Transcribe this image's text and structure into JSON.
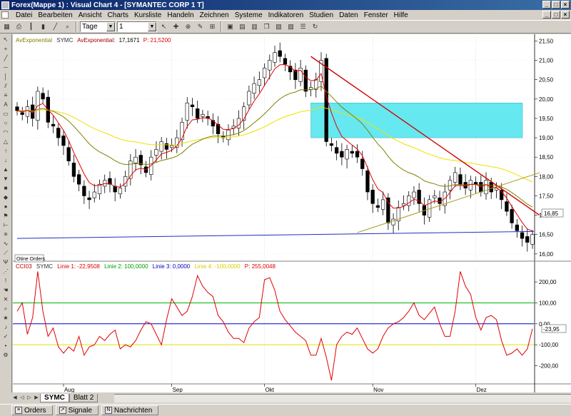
{
  "window": {
    "title": "Forex(Mappe 1) : Visual Chart 4 - [SYMANTEC CORP 1 T]",
    "min_glyph": "_",
    "max_glyph": "□",
    "close_glyph": "×"
  },
  "menu": [
    "Datei",
    "Bearbeiten",
    "Ansicht",
    "Charts",
    "Kursliste",
    "Handeln",
    "Zeichnen",
    "Systeme",
    "Indikatoren",
    "Studien",
    "Daten",
    "Fenster",
    "Hilfe"
  ],
  "toolbar": {
    "period_value": "Tage",
    "count_value": "1"
  },
  "price_legend": {
    "prefix": "AvExponential",
    "symbol": "SYMC",
    "name": "AvExponential:",
    "value": "17,1671",
    "p_label": "P: 21,5200"
  },
  "osc_legend": {
    "name": "CCI03",
    "symbol": "SYMC",
    "l1": "Linie 1: -22,9508",
    "l2": "Linie 2: 100,0000",
    "l3": "Linie 3: 0,0000",
    "l4": "Linie 4: -100,0000",
    "p": "P: 255,0048"
  },
  "orders_box": "Otine Orders",
  "price_tag": "16,85",
  "osc_tag": "-23,95",
  "sheet_tabs": [
    "SYMC",
    "Blatt 2"
  ],
  "status_tabs": [
    "Orders",
    "Signale",
    "Nachrichten"
  ],
  "colors": {
    "price_ma_fast": "#e00000",
    "price_ma_mid": "#808000",
    "price_ma_slow": "#f0e000",
    "support": "#2030c0",
    "box": "#66e8f0",
    "cci": "#e00000",
    "line_100": "#00b000",
    "line_0": "#0000c0",
    "line_m100": "#e8e000"
  },
  "chart_data": [
    {
      "type": "candlestick",
      "title": "",
      "y_ticks": [
        "21,50",
        "21,00",
        "20,50",
        "20,00",
        "19,50",
        "19,00",
        "18,50",
        "18,00",
        "17,50",
        "17,00",
        "16,50",
        "16,00"
      ],
      "ylim": [
        15.85,
        21.6
      ],
      "x_labels": [
        "Aug",
        "Sep",
        "Okt",
        "Nov",
        "Dez"
      ],
      "x_label_index": [
        9,
        30,
        48,
        69,
        89
      ],
      "n_bars": 101,
      "series": [
        {
          "name": "SYMC",
          "closes": [
            19.7,
            19.6,
            19.8,
            19.5,
            20.2,
            20.0,
            19.4,
            19.3,
            19.0,
            18.8,
            18.4,
            18.0,
            17.8,
            17.5,
            17.4,
            17.6,
            17.8,
            17.9,
            17.8,
            17.6,
            17.7,
            18.0,
            18.4,
            18.5,
            18.3,
            18.1,
            18.5,
            18.7,
            18.9,
            18.7,
            18.8,
            19.0,
            19.4,
            19.9,
            19.8,
            19.5,
            19.6,
            19.5,
            19.3,
            19.1,
            19.0,
            19.2,
            19.3,
            19.5,
            19.8,
            20.2,
            20.4,
            20.5,
            20.8,
            21.0,
            21.2,
            21.1,
            20.9,
            20.7,
            20.5,
            20.8,
            20.2,
            20.3,
            20.5,
            21.0,
            18.9,
            18.8,
            18.6,
            18.5,
            18.7,
            18.6,
            18.5,
            18.2,
            17.6,
            17.3,
            17.2,
            17.4,
            16.8,
            16.9,
            17.2,
            17.3,
            17.5,
            17.6,
            17.3,
            17.0,
            17.4,
            17.5,
            17.3,
            17.6,
            17.9,
            18.1,
            17.8,
            17.7,
            17.9,
            17.8,
            17.6,
            17.9,
            17.6,
            17.7,
            17.4,
            17.1,
            16.8,
            16.6,
            16.4,
            16.3,
            16.5
          ]
        }
      ],
      "overlays": [
        {
          "name": "fast",
          "values": "ema5"
        },
        {
          "name": "mid",
          "values": "ema20"
        },
        {
          "name": "slow",
          "values": "ema50"
        }
      ],
      "support_line": {
        "from": [
          0,
          16.4
        ],
        "to": [
          100,
          16.58
        ]
      },
      "trend_down": {
        "from": [
          57,
          21.1
        ],
        "to": [
          100,
          17.0
        ]
      },
      "trend_up": {
        "from": [
          66,
          16.55
        ],
        "to": [
          100,
          18.1
        ]
      },
      "zone": {
        "x": [
          57,
          100
        ],
        "y": [
          19.0,
          19.9
        ]
      }
    },
    {
      "type": "line",
      "title": "",
      "y_ticks": [
        "200,00",
        "100,00",
        "0,00",
        "-100,00",
        "-200,00"
      ],
      "ylim": [
        -280,
        265
      ],
      "series": [
        {
          "name": "CCI03",
          "values": [
            60,
            100,
            -50,
            30,
            250,
            60,
            -60,
            -20,
            -110,
            -140,
            -110,
            -130,
            -60,
            -150,
            -110,
            -100,
            -60,
            -80,
            -50,
            -30,
            -120,
            -100,
            -110,
            -80,
            -30,
            10,
            0,
            -50,
            -100,
            20,
            120,
            80,
            40,
            60,
            130,
            230,
            180,
            150,
            130,
            40,
            10,
            -40,
            -70,
            -70,
            -90,
            -20,
            10,
            30,
            210,
            220,
            160,
            60,
            20,
            -10,
            -40,
            -60,
            -80,
            -150,
            -150,
            -70,
            -160,
            -270,
            -100,
            -60,
            -40,
            -50,
            -20,
            -70,
            -120,
            -140,
            -120,
            -60,
            -20,
            0,
            10,
            30,
            60,
            100,
            40,
            20,
            50,
            80,
            0,
            -60,
            -60,
            60,
            250,
            180,
            140,
            30,
            -30,
            30,
            40,
            20,
            -80,
            -150,
            -140,
            -120,
            -150,
            -120,
            -24
          ]
        }
      ],
      "h_lines": [
        100,
        0,
        -100
      ]
    }
  ]
}
